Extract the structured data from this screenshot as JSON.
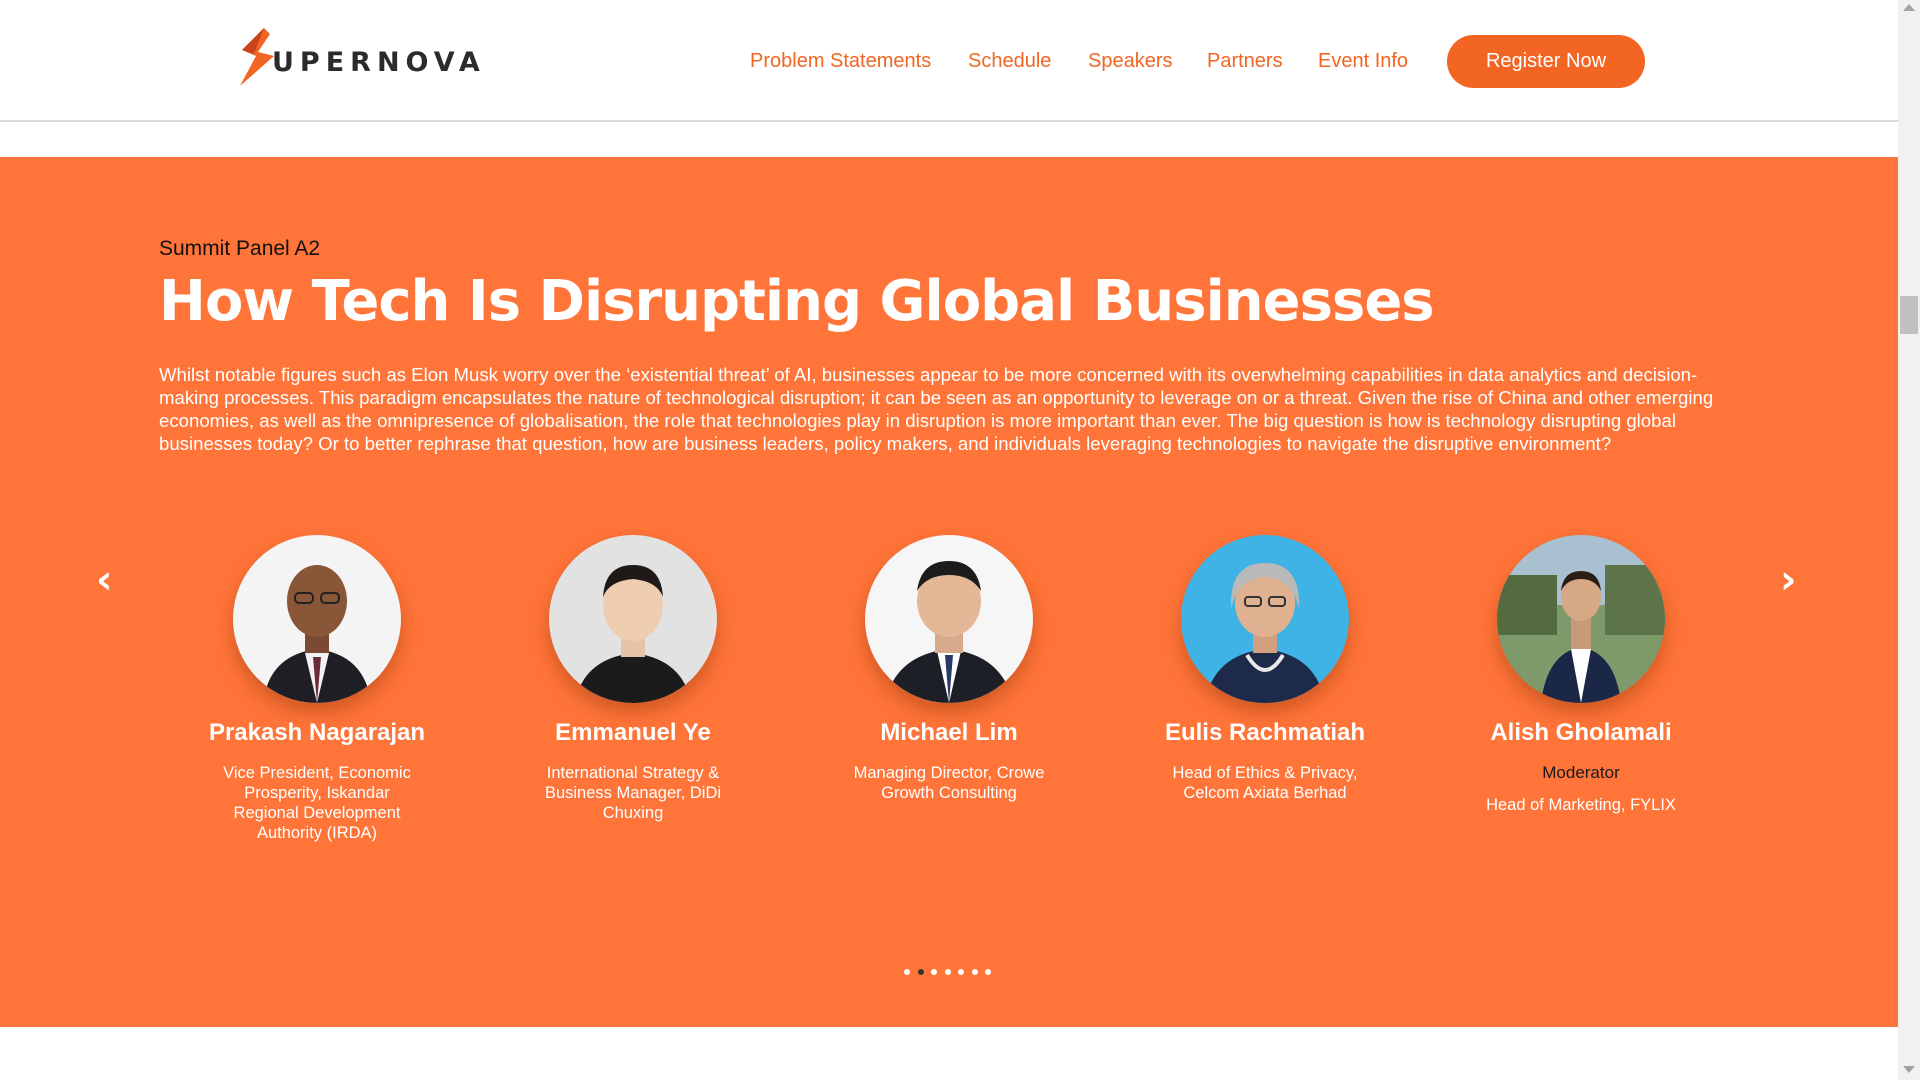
{
  "header": {
    "logo_text": "UPERNOVA",
    "nav": [
      "Problem Statements",
      "Schedule",
      "Speakers",
      "Partners",
      "Event Info"
    ],
    "register_label": "Register Now"
  },
  "panel": {
    "eyebrow": "Summit Panel A2",
    "title": "How Tech Is Disrupting Global Businesses",
    "description": "Whilst notable figures such as Elon Musk worry over the ‘existential threat’ of AI, businesses appear to be more concerned with its overwhelming capabilities in data analytics and decision-making processes. This paradigm encapsulates the nature of technological disruption; it can be seen as an opportunity to leverage on or a threat. Given the rise of China and other emerging economies, as well as the omnipresence of globalisation, the role that technologies play in disruption is more important than ever. The big question is how is technology disrupting global businesses today? Or to better rephrase that question, how are business leaders, policy makers, and individuals leveraging technologies to navigate the disruptive environment?",
    "speakers": [
      {
        "name": "Prakash Nagarajan",
        "title": "Vice President, Economic Prosperity, Iskandar Regional Development Authority (IRDA)"
      },
      {
        "name": "Emmanuel Ye",
        "title": "International Strategy & Business Manager, DiDi Chuxing"
      },
      {
        "name": "Michael Lim",
        "title": "Managing Director, Crowe Growth Consulting"
      },
      {
        "name": "Eulis Rachmatiah",
        "title": "Head of Ethics & Privacy, Celcom Axiata Berhad"
      },
      {
        "name": "Alish Gholamali",
        "role": "Moderator",
        "title": "Head of Marketing, FYLIX"
      }
    ],
    "carousel": {
      "prev_icon": "chevron-left-icon",
      "next_icon": "chevron-right-icon",
      "prev_glyph": "‹",
      "next_glyph": "›",
      "pages": 7,
      "active_page": 2
    }
  },
  "colors": {
    "brand": "#f26522",
    "panel_bg": "#ff7438"
  }
}
